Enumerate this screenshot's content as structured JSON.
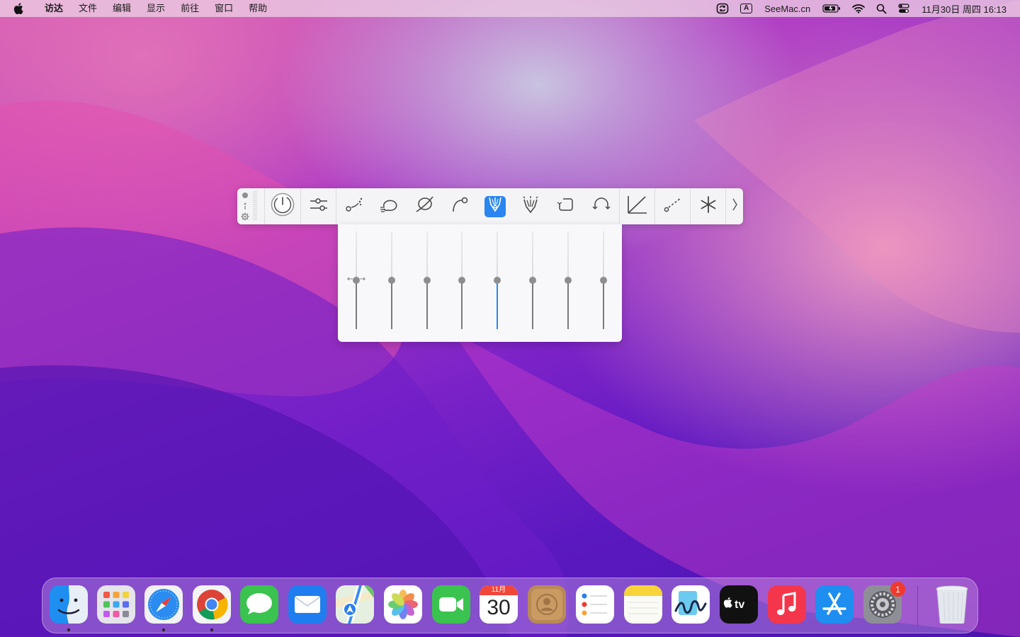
{
  "menubar": {
    "app_name": "访达",
    "menus": [
      "文件",
      "编辑",
      "显示",
      "前往",
      "窗口",
      "帮助"
    ],
    "input_method": "A",
    "site": "SeeMac.cn",
    "datetime": "11月30日 周四  16:13",
    "icons": [
      "sync-icon",
      "battery-charging-icon",
      "wifi-icon",
      "search-icon",
      "control-center-icon"
    ]
  },
  "palette": {
    "tools": [
      {
        "name": "power",
        "icon": "power-icon"
      },
      {
        "name": "adjust",
        "icon": "sliders-icon"
      },
      {
        "name": "dotted-curve",
        "icon": "dotted-curve-icon"
      },
      {
        "name": "lasso",
        "icon": "lasso-icon"
      },
      {
        "name": "loop",
        "icon": "loop-curve-icon"
      },
      {
        "name": "arc",
        "icon": "arc-pen-icon"
      },
      {
        "name": "pen-nib",
        "icon": "pen-nib-icon",
        "active": true
      },
      {
        "name": "brush",
        "icon": "brush-icon"
      },
      {
        "name": "corner",
        "icon": "corner-curve-icon"
      },
      {
        "name": "bridge",
        "icon": "bridge-curve-icon"
      },
      {
        "name": "angle",
        "icon": "angle-icon"
      },
      {
        "name": "dashed-line",
        "icon": "dashed-line-icon"
      },
      {
        "name": "asterisk",
        "icon": "asterisk-icon"
      }
    ],
    "more_icon": "chevron-right-icon",
    "accent": "#2a86f0"
  },
  "sliders": [
    {
      "level": 0.5,
      "active": false
    },
    {
      "level": 0.5,
      "active": false
    },
    {
      "level": 0.5,
      "active": false
    },
    {
      "level": 0.5,
      "active": false
    },
    {
      "level": 0.5,
      "active": true
    },
    {
      "level": 0.5,
      "active": false
    },
    {
      "level": 0.5,
      "active": false
    },
    {
      "level": 0.5,
      "active": false
    }
  ],
  "dock": {
    "apps": [
      "Finder",
      "Launchpad",
      "Safari",
      "Chrome",
      "Messages",
      "Mail",
      "Maps",
      "Photos",
      "FaceTime",
      "Calendar",
      "Contacts",
      "Reminders",
      "Notes",
      "Freeform",
      "TV",
      "Music",
      "App Store",
      "System Settings"
    ],
    "calendar_month": "11月",
    "calendar_day": "30",
    "settings_badge": "1",
    "trash": "Trash"
  }
}
